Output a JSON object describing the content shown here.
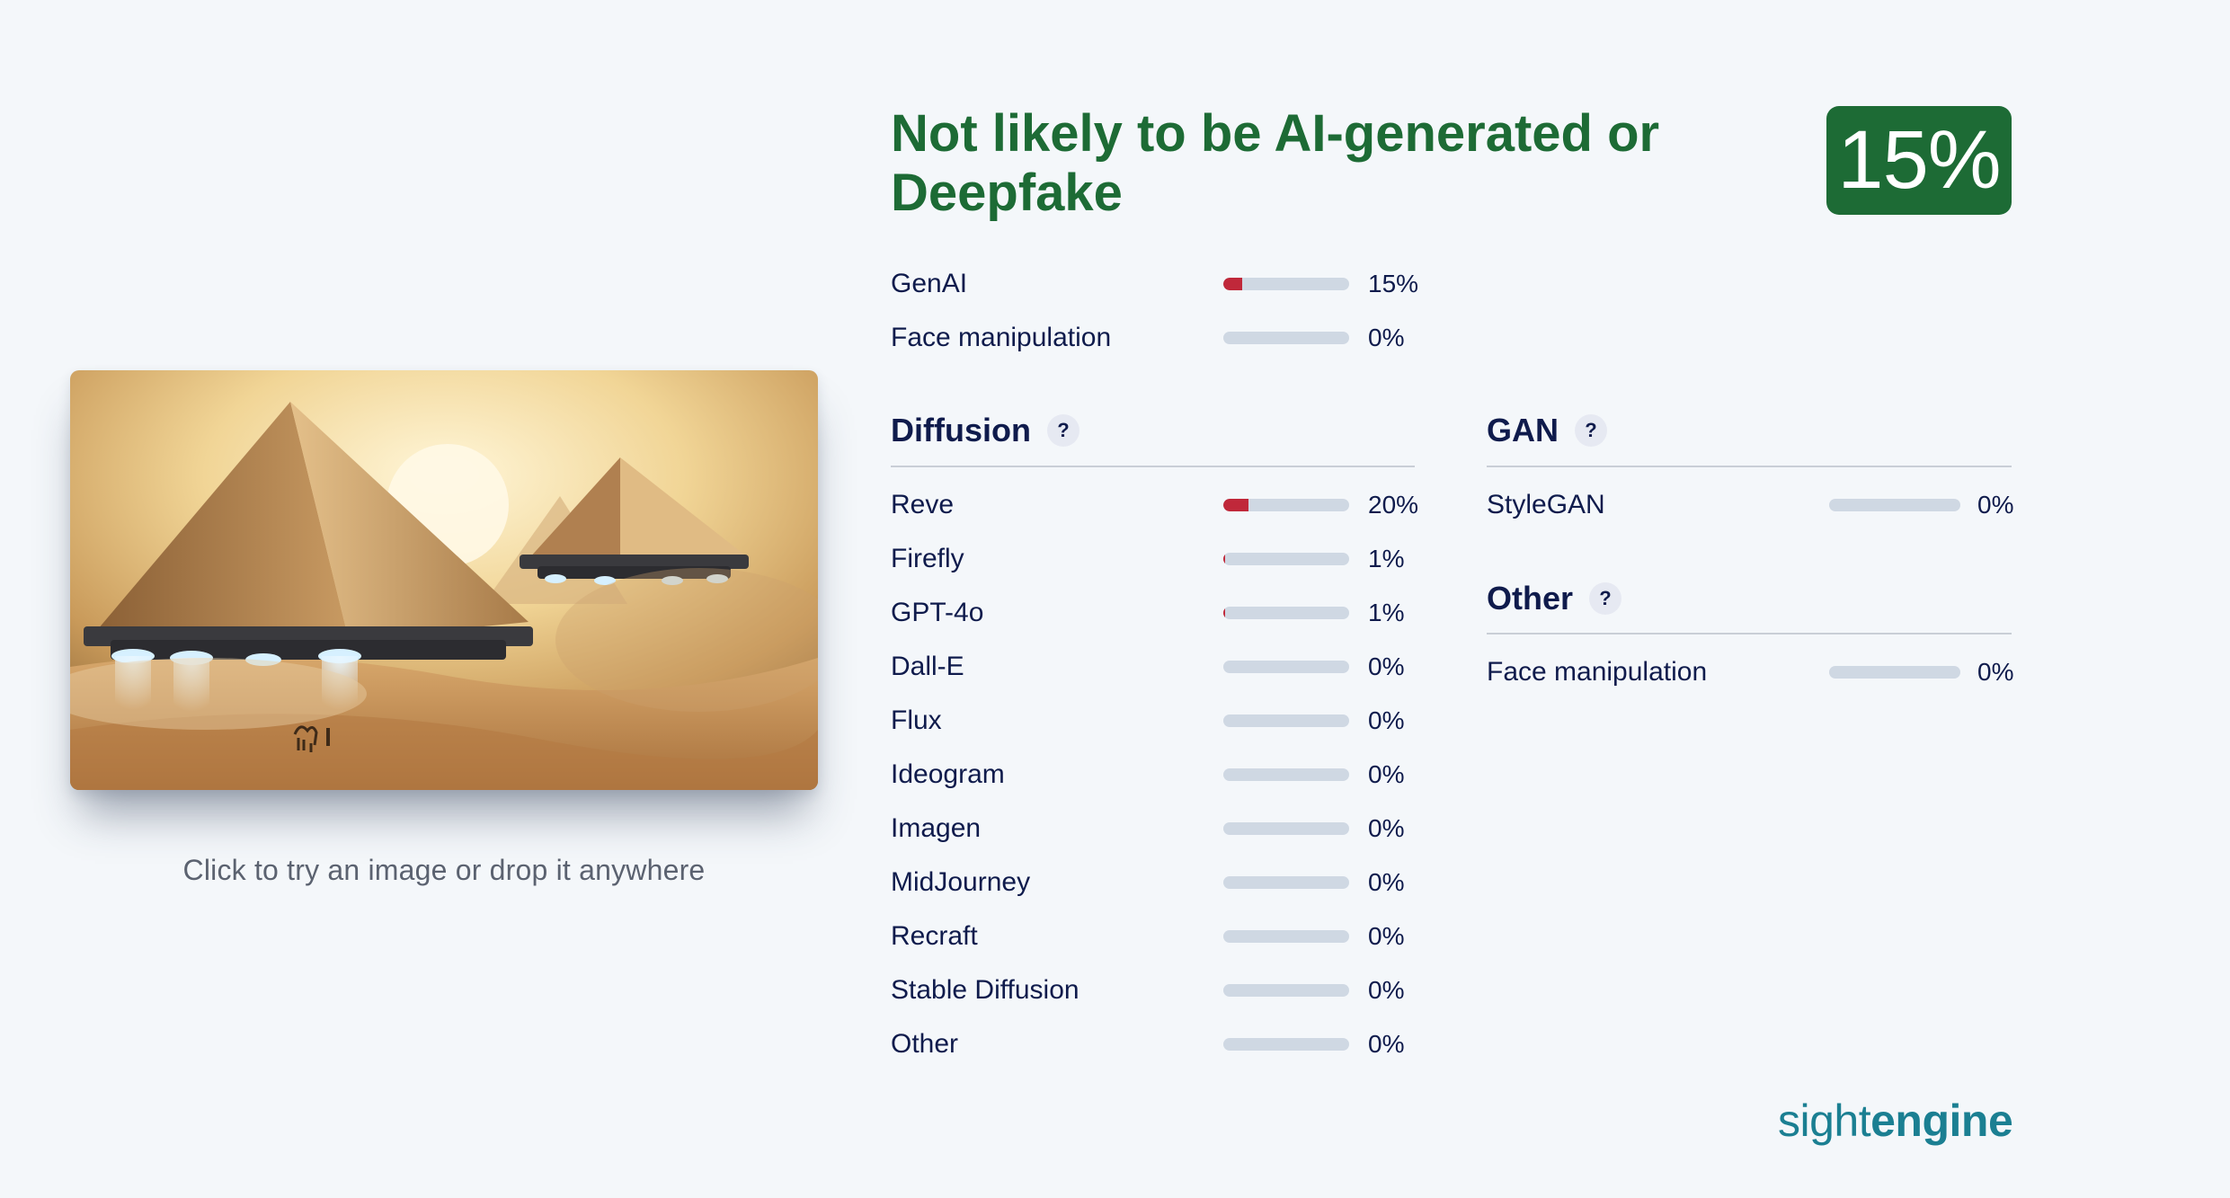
{
  "image": {
    "alt_icon": "uploaded-image-pyramids"
  },
  "drop_hint": "Click to try an image or drop it anywhere",
  "verdict": "Not likely to be AI-generated or Deepfake",
  "score": "15%",
  "summary": [
    {
      "label": "GenAI",
      "value": 0.15,
      "pct": "15%"
    },
    {
      "label": "Face manipulation",
      "value": 0,
      "pct": "0%"
    }
  ],
  "diffusion": {
    "title": "Diffusion",
    "help": "?",
    "items": [
      {
        "label": "Reve",
        "value": 0.2,
        "pct": "20%"
      },
      {
        "label": "Firefly",
        "value": 0.01,
        "pct": "1%"
      },
      {
        "label": "GPT-4o",
        "value": 0.01,
        "pct": "1%"
      },
      {
        "label": "Dall-E",
        "value": 0,
        "pct": "0%"
      },
      {
        "label": "Flux",
        "value": 0,
        "pct": "0%"
      },
      {
        "label": "Ideogram",
        "value": 0,
        "pct": "0%"
      },
      {
        "label": "Imagen",
        "value": 0,
        "pct": "0%"
      },
      {
        "label": "MidJourney",
        "value": 0,
        "pct": "0%"
      },
      {
        "label": "Recraft",
        "value": 0,
        "pct": "0%"
      },
      {
        "label": "Stable Diffusion",
        "value": 0,
        "pct": "0%"
      },
      {
        "label": "Other",
        "value": 0,
        "pct": "0%"
      }
    ]
  },
  "gan": {
    "title": "GAN",
    "help": "?",
    "items": [
      {
        "label": "StyleGAN",
        "value": 0,
        "pct": "0%"
      }
    ]
  },
  "other": {
    "title": "Other",
    "help": "?",
    "items": [
      {
        "label": "Face manipulation",
        "value": 0,
        "pct": "0%"
      }
    ]
  },
  "logo": {
    "light": "sight",
    "bold": "engine"
  },
  "colors": {
    "verdict_green": "#1d6b35",
    "bar_fill": "#c0283a",
    "bar_track": "#cfd8e3",
    "logo": "#1b7f92"
  }
}
